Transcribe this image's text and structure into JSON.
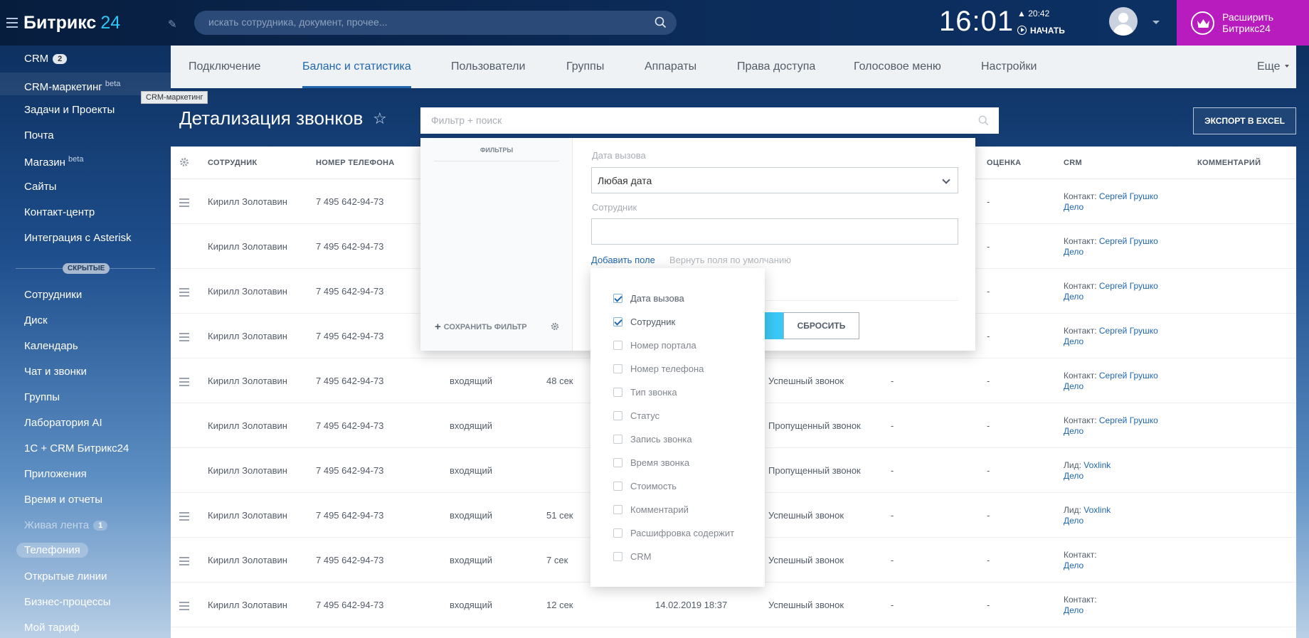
{
  "topbar": {
    "logo_main": "Битрикс",
    "logo_num": "24",
    "search_placeholder": "искать сотрудника, документ, прочее...",
    "clock": "16:01",
    "alarm_time": "20:42",
    "start_label": "НАЧАТЬ",
    "upgrade_line1": "Расширить",
    "upgrade_line2": "Битрикс24"
  },
  "sidebar": {
    "items": [
      {
        "label": "CRM",
        "counter": "2"
      },
      {
        "label": "CRM-маркетинг",
        "sup": "beta"
      },
      {
        "label": "Задачи и Проекты"
      },
      {
        "label": "Почта"
      },
      {
        "label": "Магазин",
        "sup": "beta"
      },
      {
        "label": "Сайты"
      },
      {
        "label": "Контакт-центр"
      },
      {
        "label": "Интеграция с Asterisk"
      }
    ],
    "tooltip": "CRM-маркетинг",
    "hidden_label": "СКРЫТЫЕ",
    "hidden_items": [
      {
        "label": "Сотрудники"
      },
      {
        "label": "Диск"
      },
      {
        "label": "Календарь"
      },
      {
        "label": "Чат и звонки"
      },
      {
        "label": "Группы"
      },
      {
        "label": "Лаборатория AI"
      },
      {
        "label": "1С + CRM Битрикс24"
      },
      {
        "label": "Приложения"
      },
      {
        "label": "Время и отчеты"
      },
      {
        "label": "Живая лента",
        "counter": "1"
      },
      {
        "label": "Телефония"
      },
      {
        "label": "Открытые линии"
      },
      {
        "label": "Бизнес-процессы"
      },
      {
        "label": "Мой тариф"
      }
    ]
  },
  "tabs": [
    "Подключение",
    "Баланс и статистика",
    "Пользователи",
    "Группы",
    "Аппараты",
    "Права доступа",
    "Голосовое меню",
    "Настройки",
    "Еще"
  ],
  "page": {
    "title": "Детализация звонков",
    "filter_placeholder": "Фильтр + поиск",
    "export_label": "ЭКСПОРТ В EXCEL"
  },
  "grid": {
    "headers": {
      "employee": "СОТРУДНИК",
      "phone": "НОМЕР ТЕЛЕФОНА",
      "rating": "ОЦЕНКА",
      "crm": "CRM",
      "comment": "КОММЕНТАРИЙ"
    },
    "rows": [
      {
        "employee": "Кирилл Золотавин",
        "phone": "7 495 642-94-73",
        "type": "",
        "duration": "",
        "date": "",
        "status": "",
        "cost": "",
        "rating": "-",
        "crm_prefix": "Контакт: ",
        "crm_link": "Сергей Грушко",
        "crm_deal": "Дело"
      },
      {
        "employee": "Кирилл Золотавин",
        "phone": "7 495 642-94-73",
        "type": "",
        "duration": "",
        "date": "",
        "status": "",
        "cost": "",
        "rating": "-",
        "crm_prefix": "Контакт: ",
        "crm_link": "Сергей Грушко",
        "crm_deal": "Дело"
      },
      {
        "employee": "Кирилл Золотавин",
        "phone": "7 495 642-94-73",
        "type": "",
        "duration": "",
        "date": "",
        "status": "",
        "cost": "",
        "rating": "-",
        "crm_prefix": "Контакт: ",
        "crm_link": "Сергей Грушко",
        "crm_deal": "Дело"
      },
      {
        "employee": "Кирилл Золотавин",
        "phone": "7 495 642-94-73",
        "type": "",
        "duration": "",
        "date": "",
        "status": "",
        "cost": "",
        "rating": "-",
        "crm_prefix": "Контакт: ",
        "crm_link": "Сергей Грушко",
        "crm_deal": "Дело"
      },
      {
        "employee": "Кирилл Золотавин",
        "phone": "7 495 642-94-73",
        "type": "входящий",
        "duration": "48 сек",
        "date": "",
        "status": "Успешный звонок",
        "cost": "-",
        "rating": "-",
        "crm_prefix": "Контакт: ",
        "crm_link": "Сергей Грушко",
        "crm_deal": "Дело"
      },
      {
        "employee": "Кирилл Золотавин",
        "phone": "7 495 642-94-73",
        "type": "входящий",
        "duration": "",
        "date": "",
        "status": "Пропущенный звонок",
        "cost": "-",
        "rating": "-",
        "crm_prefix": "Контакт: ",
        "crm_link": "Сергей Грушко",
        "crm_deal": "Дело"
      },
      {
        "employee": "Кирилл Золотавин",
        "phone": "7 495 642-94-73",
        "type": "входящий",
        "duration": "",
        "date": "",
        "status": "Пропущенный звонок",
        "cost": "-",
        "rating": "-",
        "crm_prefix": "Лид: ",
        "crm_link": "Voxlink",
        "crm_deal": "Дело"
      },
      {
        "employee": "Кирилл Золотавин",
        "phone": "7 495 642-94-73",
        "type": "входящий",
        "duration": "51 сек",
        "date": "",
        "status": "Успешный звонок",
        "cost": "-",
        "rating": "-",
        "crm_prefix": "Лид: ",
        "crm_link": "Voxlink",
        "crm_deal": "Дело"
      },
      {
        "employee": "Кирилл Золотавин",
        "phone": "7 495 642-94-73",
        "type": "входящий",
        "duration": "7 сек",
        "date": "",
        "status": "Успешный звонок",
        "cost": "-",
        "rating": "-",
        "crm_prefix": "Контакт:",
        "crm_link": "",
        "crm_deal": "Дело"
      },
      {
        "employee": "Кирилл Золотавин",
        "phone": "7 495 642-94-73",
        "type": "входящий",
        "duration": "12 сек",
        "date": "14.02.2019 18:37",
        "status": "Успешный звонок",
        "cost": "-",
        "rating": "-",
        "crm_prefix": "Контакт:",
        "crm_link": "",
        "crm_deal": "Дело"
      }
    ]
  },
  "filter": {
    "left_title": "ФИЛЬТРЫ",
    "save_filter": "СОХРАНИТЬ ФИЛЬТР",
    "date_label": "Дата вызова",
    "date_value": "Любая дата",
    "employee_label": "Сотрудник",
    "employee_value": "",
    "add_field": "Добавить поле",
    "reset_fields": "Вернуть поля по умолчанию",
    "reset_button": "СБРОСИТЬ",
    "fields": [
      {
        "label": "Дата вызова",
        "checked": true
      },
      {
        "label": "Сотрудник",
        "checked": true
      },
      {
        "label": "Номер портала",
        "checked": false
      },
      {
        "label": "Номер телефона",
        "checked": false
      },
      {
        "label": "Тип звонка",
        "checked": false
      },
      {
        "label": "Статус",
        "checked": false
      },
      {
        "label": "Запись звонка",
        "checked": false
      },
      {
        "label": "Время звонка",
        "checked": false
      },
      {
        "label": "Стоимость",
        "checked": false
      },
      {
        "label": "Комментарий",
        "checked": false
      },
      {
        "label": "Расшифровка содержит",
        "checked": false
      },
      {
        "label": "CRM",
        "checked": false
      }
    ]
  },
  "colors": {
    "accent": "#2067b0",
    "upgrade": "#b91cbe",
    "find_button": "#3bc8f5"
  }
}
